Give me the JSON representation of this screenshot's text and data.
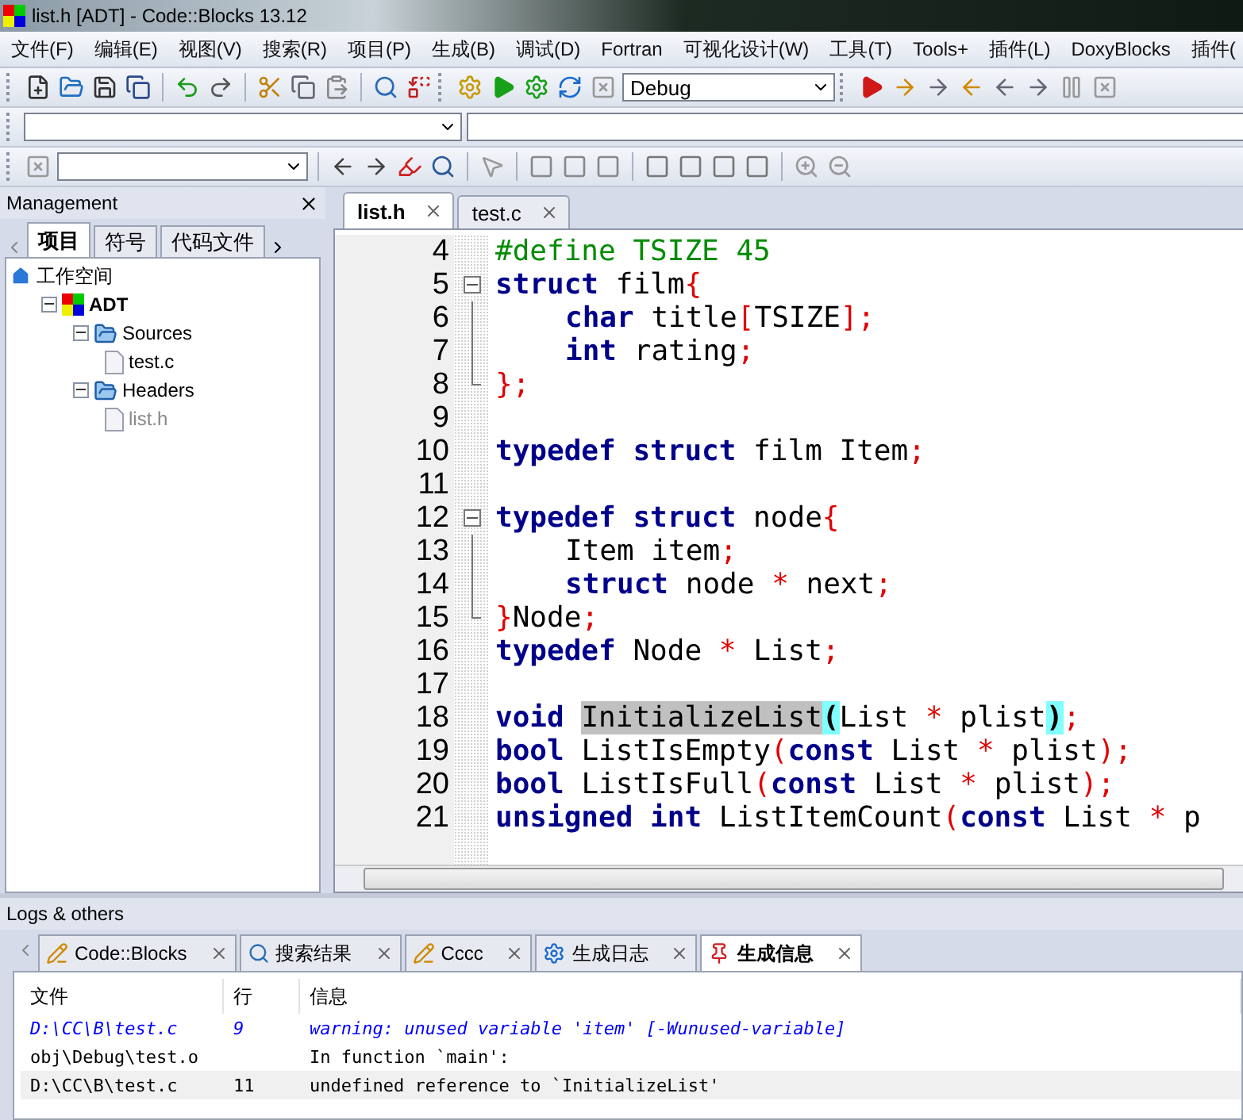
{
  "window": {
    "title": "list.h [ADT] - Code::Blocks 13.12"
  },
  "menu": [
    "文件(F)",
    "编辑(E)",
    "视图(V)",
    "搜索(R)",
    "项目(P)",
    "生成(B)",
    "调试(D)",
    "Fortran",
    "可视化设计(W)",
    "工具(T)",
    "Tools+",
    "插件(L)",
    "DoxyBlocks",
    "插件("
  ],
  "toolbar": {
    "build_target": "Debug"
  },
  "management": {
    "title": "Management",
    "tabs": [
      {
        "label": "项目",
        "selected": true
      },
      {
        "label": "符号",
        "selected": false
      },
      {
        "label": "代码文件",
        "selected": false
      }
    ],
    "tree": [
      {
        "label": "工作空间",
        "kind": "workspace",
        "children": [
          {
            "label": "ADT",
            "kind": "project",
            "expanded": true,
            "children": [
              {
                "label": "Sources",
                "kind": "folder",
                "expanded": true,
                "children": [
                  {
                    "label": "test.c",
                    "kind": "file",
                    "dimmed": false
                  }
                ]
              },
              {
                "label": "Headers",
                "kind": "folder",
                "expanded": true,
                "children": [
                  {
                    "label": "list.h",
                    "kind": "file",
                    "dimmed": true
                  }
                ]
              }
            ]
          }
        ]
      }
    ]
  },
  "editor": {
    "tabs": [
      {
        "label": "list.h",
        "selected": true
      },
      {
        "label": "test.c",
        "selected": false
      }
    ],
    "lines": [
      {
        "number": "4",
        "kind": "plain",
        "tokens": [
          {
            "kind": "pp",
            "text": "#define TSIZE 45"
          }
        ]
      },
      {
        "number": "5",
        "kind": "start",
        "tokens": [
          {
            "kind": "kw",
            "text": "struct"
          },
          {
            "kind": "id",
            "text": " film"
          },
          {
            "kind": "op",
            "text": "{"
          }
        ]
      },
      {
        "number": "6",
        "kind": "body",
        "indented": true,
        "tokens": [
          {
            "kind": "kw",
            "text": "char"
          },
          {
            "kind": "id",
            "text": " title"
          },
          {
            "kind": "op",
            "text": "["
          },
          {
            "kind": "id",
            "text": "TSIZE"
          },
          {
            "kind": "op",
            "text": "];"
          }
        ]
      },
      {
        "number": "7",
        "kind": "body",
        "indented": true,
        "tokens": [
          {
            "kind": "kw",
            "text": "int"
          },
          {
            "kind": "id",
            "text": " rating"
          },
          {
            "kind": "op",
            "text": ";"
          }
        ]
      },
      {
        "number": "8",
        "kind": "end",
        "tokens": [
          {
            "kind": "op",
            "text": "};"
          }
        ]
      },
      {
        "number": "9",
        "kind": "plain"
      },
      {
        "number": "10",
        "kind": "plain",
        "tokens": [
          {
            "kind": "kw",
            "text": "typedef struct"
          },
          {
            "kind": "id",
            "text": " film Item"
          },
          {
            "kind": "op",
            "text": ";"
          }
        ]
      },
      {
        "number": "11",
        "kind": "plain"
      },
      {
        "number": "12",
        "kind": "start",
        "tokens": [
          {
            "kind": "kw",
            "text": "typedef struct"
          },
          {
            "kind": "id",
            "text": " node"
          },
          {
            "kind": "op",
            "text": "{"
          }
        ]
      },
      {
        "number": "13",
        "kind": "body",
        "indented": true,
        "tokens": [
          {
            "kind": "id",
            "text": "Item item"
          },
          {
            "kind": "op",
            "text": ";"
          }
        ]
      },
      {
        "number": "14",
        "kind": "body",
        "indented": true,
        "tokens": [
          {
            "kind": "kw",
            "text": "struct"
          },
          {
            "kind": "id",
            "text": " node "
          },
          {
            "kind": "op",
            "text": "*"
          },
          {
            "kind": "id",
            "text": " next"
          },
          {
            "kind": "op",
            "text": ";"
          }
        ]
      },
      {
        "number": "15",
        "kind": "end",
        "tokens": [
          {
            "kind": "op",
            "text": "}"
          },
          {
            "kind": "id",
            "text": "Node"
          },
          {
            "kind": "op",
            "text": ";"
          }
        ]
      },
      {
        "number": "16",
        "kind": "plain",
        "tokens": [
          {
            "kind": "kw",
            "text": "typedef"
          },
          {
            "kind": "id",
            "text": " Node "
          },
          {
            "kind": "op",
            "text": "*"
          },
          {
            "kind": "id",
            "text": " List"
          },
          {
            "kind": "op",
            "text": ";"
          }
        ]
      },
      {
        "number": "17",
        "kind": "plain"
      },
      {
        "number": "18",
        "kind": "plain",
        "tokens": [
          {
            "kind": "kw",
            "text": "void "
          },
          {
            "kind": "hl",
            "text": "InitializeList"
          },
          {
            "kind": "brace",
            "text": "("
          },
          {
            "kind": "id",
            "text": "List "
          },
          {
            "kind": "op",
            "text": "*"
          },
          {
            "kind": "id",
            "text": " plist"
          },
          {
            "kind": "brace",
            "text": ")"
          },
          {
            "kind": "op",
            "text": ";"
          }
        ]
      },
      {
        "number": "19",
        "kind": "plain",
        "tokens": [
          {
            "kind": "kw",
            "text": "bool"
          },
          {
            "kind": "id",
            "text": " ListIsEmpty"
          },
          {
            "kind": "op",
            "text": "("
          },
          {
            "kind": "kw",
            "text": "const"
          },
          {
            "kind": "id",
            "text": " List "
          },
          {
            "kind": "op",
            "text": "*"
          },
          {
            "kind": "id",
            "text": " plist"
          },
          {
            "kind": "op",
            "text": ");"
          }
        ]
      },
      {
        "number": "20",
        "kind": "plain",
        "tokens": [
          {
            "kind": "kw",
            "text": "bool"
          },
          {
            "kind": "id",
            "text": " ListIsFull"
          },
          {
            "kind": "op",
            "text": "("
          },
          {
            "kind": "kw",
            "text": "const"
          },
          {
            "kind": "id",
            "text": " List "
          },
          {
            "kind": "op",
            "text": "*"
          },
          {
            "kind": "id",
            "text": " plist"
          },
          {
            "kind": "op",
            "text": ");"
          }
        ]
      },
      {
        "number": "21",
        "kind": "plain",
        "tokens": [
          {
            "kind": "kw",
            "text": "unsigned int"
          },
          {
            "kind": "id",
            "text": " ListItemCount"
          },
          {
            "kind": "op",
            "text": "("
          },
          {
            "kind": "kw",
            "text": "const"
          },
          {
            "kind": "id",
            "text": " List "
          },
          {
            "kind": "op",
            "text": "*"
          },
          {
            "kind": "id",
            "text": " p"
          }
        ]
      }
    ]
  },
  "logs": {
    "title": "Logs & others",
    "tabs": [
      {
        "label": "Code::Blocks",
        "kind": "note",
        "selected": false
      },
      {
        "label": "搜索结果",
        "kind": "search",
        "selected": false
      },
      {
        "label": "Cccc",
        "kind": "note",
        "selected": false
      },
      {
        "label": "生成日志",
        "kind": "gear",
        "selected": false
      },
      {
        "label": "生成信息",
        "kind": "pin",
        "selected": true
      }
    ],
    "columns": [
      "文件",
      "行",
      "信息"
    ],
    "rows": [
      {
        "file": "D:\\CC\\B\\test.c",
        "line": "9",
        "message": "warning: unused variable 'item' [-Wunused-variable]",
        "kind": "warning",
        "selected": false
      },
      {
        "file": "obj\\Debug\\test.o",
        "message": "In function `main':",
        "kind": "normal",
        "selected": false
      },
      {
        "file": "D:\\CC\\B\\test.c",
        "line": "11",
        "message": "undefined reference to `InitializeList'",
        "kind": "normal",
        "selected": true
      }
    ]
  }
}
